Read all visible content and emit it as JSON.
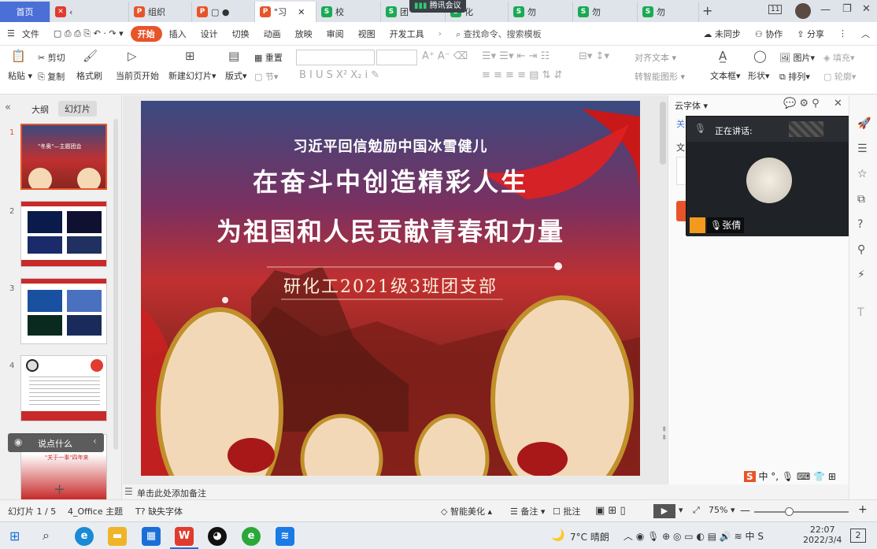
{
  "tabs": [
    {
      "label": "首页",
      "color": "#e03b2f"
    },
    {
      "label": "",
      "color": "#e03b2f"
    },
    {
      "label": "",
      "color": "#e8542a"
    },
    {
      "label": "组织",
      "color": "#e8542a"
    },
    {
      "label": "",
      "color": "#e8542a"
    },
    {
      "label": "\"习",
      "color": "#e8542a"
    },
    {
      "label": "校",
      "color": "#1aaa55"
    },
    {
      "label": "团",
      "color": "#1aaa55"
    },
    {
      "label": "化",
      "color": "#1aaa55"
    },
    {
      "label": "勿",
      "color": "#1aaa55"
    },
    {
      "label": "勿",
      "color": "#1aaa55"
    },
    {
      "label": "勿",
      "color": "#1aaa55"
    }
  ],
  "meeting_banner": "腾讯会议",
  "window_num": "11",
  "menu": {
    "file": "文件",
    "items": [
      "开始",
      "插入",
      "设计",
      "切换",
      "动画",
      "放映",
      "审阅",
      "视图",
      "开发工具"
    ],
    "search": "查找命令、搜索模板",
    "sync": "未同步",
    "collab": "协作",
    "share": "分享"
  },
  "ribbon": {
    "paste": "粘贴",
    "cut": "剪切",
    "copy": "复制",
    "format_painter": "格式刷",
    "from_current": "当前页开始",
    "new_slide": "新建幻灯片",
    "layout": "版式",
    "reset": "重置",
    "section": "节",
    "align_text": "对齐文本",
    "smart_shape": "转智能图形",
    "textbox": "文本框",
    "shape": "形状",
    "picture": "图片",
    "arrange": "排列",
    "fill": "填充",
    "outline": "轮廓"
  },
  "left_panel": {
    "tab_outline": "大纲",
    "tab_slides": "幻灯片",
    "slide_numbers": [
      "1",
      "2",
      "3",
      "4"
    ],
    "talk_placeholder": "说点什么"
  },
  "slide": {
    "line1": "习近平回信勉励中国冰雪健儿",
    "line2": "在奋斗中创造精彩人生",
    "line3": "为祖国和人民贡献青春和力量",
    "line4": "研化工2021级3班团支部"
  },
  "thumb1_title": "\"冬奥\"—主题团会",
  "thumb5_title": "\"关于一事\"四年来",
  "notes_placeholder": "单击此处添加备注",
  "right_panel": {
    "title": "云字体",
    "first_chars": [
      "关",
      "文"
    ]
  },
  "meeting": {
    "speaking_label": "正在讲话:",
    "speaker": "张倩"
  },
  "status": {
    "slide_info": "幻灯片 1 / 5",
    "theme": "4_Office 主题",
    "missing_font": "缺失字体",
    "beautify": "智能美化",
    "notes": "备注",
    "comments": "批注",
    "zoom": "75%"
  },
  "taskbar": {
    "weather": "7°C 晴朗",
    "time": "22:07",
    "date": "2022/3/4",
    "notif": "2"
  }
}
